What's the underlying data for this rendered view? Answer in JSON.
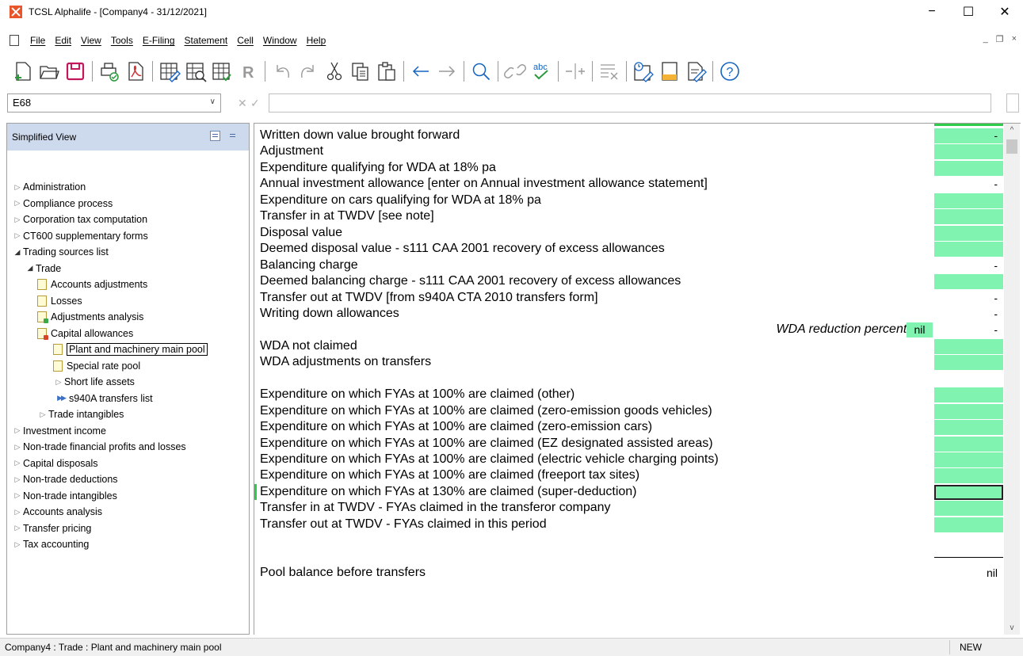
{
  "window": {
    "title": "TCSL Alphalife - [Company4 - 31/12/2021]",
    "min": "−",
    "max": "☐",
    "close": "✕"
  },
  "menu": [
    "File",
    "Edit",
    "View",
    "Tools",
    "E-Filing",
    "Statement",
    "Cell",
    "Window",
    "Help"
  ],
  "mdi": {
    "min": "_",
    "restore": "❐",
    "close": "×"
  },
  "formula": {
    "cell_ref": "E68",
    "cancel": "✕",
    "accept": "✓"
  },
  "panel": {
    "header": "Simplified View",
    "tree": [
      {
        "label": "Administration",
        "level": 0,
        "toggle": "▷"
      },
      {
        "label": "Compliance process",
        "level": 0,
        "toggle": "▷"
      },
      {
        "label": "Corporation tax computation",
        "level": 0,
        "toggle": "▷"
      },
      {
        "label": "CT600 supplementary forms",
        "level": 0,
        "toggle": "▷"
      },
      {
        "label": "Trading sources list",
        "level": 0,
        "toggle": "◢"
      },
      {
        "label": "Trade",
        "level": 1,
        "toggle": "◢"
      },
      {
        "label": "Accounts adjustments",
        "level": 2,
        "icon": "leaf"
      },
      {
        "label": "Losses",
        "level": 2,
        "icon": "leaf"
      },
      {
        "label": "Adjustments analysis",
        "level": 2,
        "icon": "leaf-badge"
      },
      {
        "label": "Capital allowances",
        "level": 2,
        "icon": "leaf-badge-red"
      },
      {
        "label": "Plant and machinery main pool",
        "level": 3,
        "icon": "leaf",
        "selected": true
      },
      {
        "label": "Special rate pool",
        "level": 3,
        "icon": "leaf"
      },
      {
        "label": "Short life assets",
        "level": 3,
        "toggle": "▷"
      },
      {
        "label": "s940A transfers list",
        "level": 3,
        "icon": "double"
      },
      {
        "label": "Trade intangibles",
        "level": 2,
        "toggle": "▷"
      },
      {
        "label": "Investment income",
        "level": 0,
        "toggle": "▷"
      },
      {
        "label": "Non-trade financial profits and losses",
        "level": 0,
        "toggle": "▷"
      },
      {
        "label": "Capital disposals",
        "level": 0,
        "toggle": "▷"
      },
      {
        "label": "Non-trade deductions",
        "level": 0,
        "toggle": "▷"
      },
      {
        "label": "Non-trade intangibles",
        "level": 0,
        "toggle": "▷"
      },
      {
        "label": "Accounts analysis",
        "level": 0,
        "toggle": "▷"
      },
      {
        "label": "Transfer pricing",
        "level": 0,
        "toggle": "▷"
      },
      {
        "label": "Tax accounting",
        "level": 0,
        "toggle": "▷"
      }
    ]
  },
  "rows": [
    {
      "label": "Written down value brought forward",
      "cell": true,
      "value": "-"
    },
    {
      "label": "Adjustment",
      "cell": true,
      "value": ""
    },
    {
      "label": "Expenditure qualifying for WDA at 18% pa",
      "cell": true,
      "value": ""
    },
    {
      "label": "Annual investment allowance [enter on Annual investment allowance statement]",
      "cell": false,
      "value": "-"
    },
    {
      "label": "Expenditure on cars qualifying for WDA at 18% pa",
      "cell": true,
      "value": ""
    },
    {
      "label": "Transfer in at TWDV [see note]",
      "cell": true,
      "value": ""
    },
    {
      "label": "Disposal value",
      "cell": true,
      "value": ""
    },
    {
      "label": "Deemed disposal value - s111 CAA 2001 recovery of excess allowances",
      "cell": true,
      "value": ""
    },
    {
      "label": "Balancing charge",
      "cell": false,
      "value": "-"
    },
    {
      "label": "Deemed balancing charge - s111 CAA 2001 recovery of excess allowances",
      "cell": true,
      "value": ""
    },
    {
      "label": "Transfer out at TWDV [from s940A CTA 2010 transfers form]",
      "cell": false,
      "value": "-"
    },
    {
      "label": "Writing down allowances",
      "cell": false,
      "value": "-"
    },
    {
      "label": "",
      "cell": false,
      "value": "-",
      "wda": true
    },
    {
      "label": "WDA not claimed",
      "cell": true,
      "value": ""
    },
    {
      "label": "WDA adjustments on transfers",
      "cell": true,
      "value": ""
    },
    {
      "label": "",
      "cell": false,
      "value": ""
    },
    {
      "label": "Expenditure on which FYAs at 100% are claimed (other)",
      "cell": true,
      "value": ""
    },
    {
      "label": "Expenditure on which FYAs at 100% are claimed (zero-emission goods vehicles)",
      "cell": true,
      "value": ""
    },
    {
      "label": "Expenditure on which FYAs at 100% are claimed (zero-emission cars)",
      "cell": true,
      "value": ""
    },
    {
      "label": "Expenditure on which FYAs at 100% are claimed (EZ designated assisted areas)",
      "cell": true,
      "value": ""
    },
    {
      "label": "Expenditure on which FYAs at 100% are claimed (electric vehicle charging points)",
      "cell": true,
      "value": ""
    },
    {
      "label": "Expenditure on which FYAs at 100% are claimed (freeport tax sites)",
      "cell": true,
      "value": ""
    },
    {
      "label": "Expenditure on which FYAs at 130% are claimed (super-deduction)",
      "cell": true,
      "value": "",
      "selected": true
    },
    {
      "label": "Transfer in at TWDV - FYAs claimed in the transferor company",
      "cell": true,
      "value": ""
    },
    {
      "label": "Transfer out at TWDV - FYAs claimed in this period",
      "cell": true,
      "value": ""
    },
    {
      "label": "",
      "cell": false,
      "value": ""
    },
    {
      "label": "",
      "cell": false,
      "value": "",
      "total_line": true
    },
    {
      "label": "Pool balance before transfers",
      "cell": false,
      "value": "nil"
    }
  ],
  "wda": {
    "label": "WDA reduction percentage",
    "value": "nil"
  },
  "scroll": {
    "up": "^",
    "down": "v"
  },
  "status": {
    "path": "Company4 : Trade : Plant and machinery main pool",
    "mode": "NEW"
  },
  "colors": {
    "cell_green": "#80f3b0",
    "panel_header": "#cdd9ec",
    "accent_green": "#2ecc4a"
  }
}
